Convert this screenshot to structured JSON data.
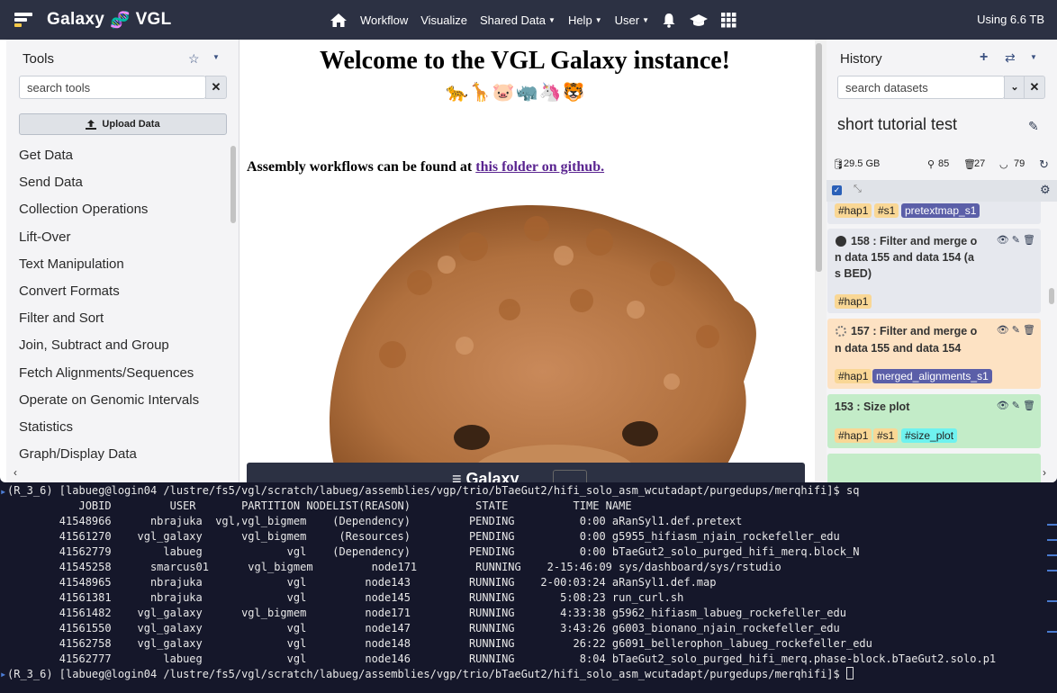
{
  "masthead": {
    "brand_left": "Galaxy",
    "brand_right": "VGL",
    "nav": [
      "Workflow",
      "Visualize",
      "Shared Data",
      "Help",
      "User"
    ],
    "usage": "Using 6.6 TB"
  },
  "tool_panel": {
    "title": "Tools",
    "search_placeholder": "search tools",
    "upload_label": "Upload Data",
    "sections": [
      "Get Data",
      "Send Data",
      "Collection Operations",
      "Lift-Over",
      "Text Manipulation",
      "Convert Formats",
      "Filter and Sort",
      "Join, Subtract and Group",
      "Fetch Alignments/Sequences",
      "Operate on Genomic Intervals",
      "Statistics",
      "Graph/Display Data"
    ]
  },
  "center": {
    "welcome": "Welcome to the VGL Galaxy instance!",
    "emojis": "🐆🦒🐷🦏🦄🐯",
    "assembly_prefix": "Assembly workflows can be found at ",
    "assembly_link": "this folder on github.",
    "embed_brand": "≡ Galaxy"
  },
  "history": {
    "title": "History",
    "search_placeholder": "search datasets",
    "name": "short tutorial test",
    "size": "29.5 GB",
    "count_shown": "85",
    "count_deleted": "27",
    "count_hidden": "79",
    "datasets": [
      {
        "title": "",
        "tags": [
          "#hap1",
          "#s1",
          "pretextmap_s1"
        ],
        "state": "ok-partial"
      },
      {
        "title": "158 : Filter and merge on data 155 and data 154 (as BED)",
        "title_lines": [
          "158 : Filter and merge o",
          "n data 155 and data 154 (a",
          "s BED)"
        ],
        "tags": [
          "#hap1"
        ],
        "state": "queued"
      },
      {
        "title_lines": [
          "157 : Filter and merge o",
          "n data 155 and data 154"
        ],
        "tags": [
          "#hap1",
          "merged_alignments_s1"
        ],
        "state": "running"
      },
      {
        "title_lines": [
          "153 : Size plot"
        ],
        "tags": [
          "#hap1",
          "#s1",
          "#size_plot"
        ],
        "state": "ok"
      }
    ]
  },
  "terminal": {
    "lines": [
      "(R_3_6) [labueg@login04 /lustre/fs5/vgl/scratch/labueg/assemblies/vgp/trio/bTaeGut2/hifi_solo_asm_wcutadapt/purgedups/merqhifi]$ sq",
      "           JOBID         USER       PARTITION NODELIST(REASON)          STATE          TIME NAME",
      "        41548966      nbrajuka  vgl,vgl_bigmem    (Dependency)         PENDING          0:00 aRanSyl1.def.pretext",
      "        41561270    vgl_galaxy      vgl_bigmem     (Resources)         PENDING          0:00 g5955_hifiasm_njain_rockefeller_edu",
      "        41562779        labueg             vgl    (Dependency)         PENDING          0:00 bTaeGut2_solo_purged_hifi_merq.block_N",
      "        41545258      smarcus01      vgl_bigmem         node171         RUNNING    2-15:46:09 sys/dashboard/sys/rstudio",
      "        41548965      nbrajuka             vgl         node143         RUNNING    2-00:03:24 aRanSyl1.def.map",
      "        41561381      nbrajuka             vgl         node145         RUNNING       5:08:23 run_curl.sh",
      "        41561482    vgl_galaxy      vgl_bigmem         node171         RUNNING       4:33:38 g5962_hifiasm_labueg_rockefeller_edu",
      "        41561550    vgl_galaxy             vgl         node147         RUNNING       3:43:26 g6003_bionano_njain_rockefeller_edu",
      "        41562758    vgl_galaxy             vgl         node148         RUNNING         26:22 g6091_bellerophon_labueg_rockefeller_edu",
      "        41562777        labueg             vgl         node146         RUNNING          8:04 bTaeGut2_solo_purged_hifi_merq.phase-block.bTaeGut2.solo.p1",
      "(R_3_6) [labueg@login04 /lustre/fs5/vgl/scratch/labueg/assemblies/vgp/trio/bTaeGut2/hifi_solo_asm_wcutadapt/purgedups/merqhifi]$ "
    ]
  },
  "colors": {
    "masthead": "#2c3143",
    "running": "#fde2c3",
    "ok": "#c3ecc8",
    "queued": "#e6e8ee",
    "tag_hap": "#f9d795",
    "tag_size": "#6ff2ef",
    "tag_name": "#5b5fa8"
  }
}
